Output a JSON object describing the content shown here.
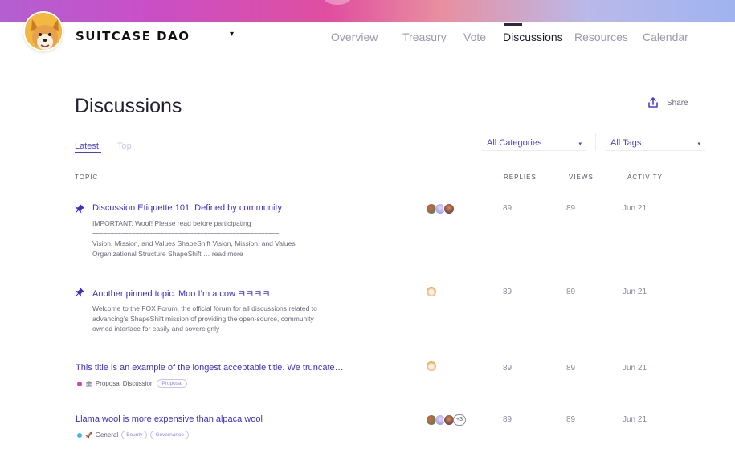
{
  "dao": {
    "name": "SUITCASE DAO",
    "menu_caret": "▾"
  },
  "nav": {
    "items": [
      "Overview",
      "Treasury",
      "Vote",
      "Discussions",
      "Resources",
      "Calendar"
    ],
    "active": "Discussions"
  },
  "page": {
    "title": "Discussions",
    "share_label": "Share"
  },
  "tabs": {
    "latest": "Latest",
    "top": "Top"
  },
  "filters": {
    "categories": "All Categories",
    "tags": "All Tags",
    "caret": "▾"
  },
  "table": {
    "headers": {
      "topic": "TOPIC",
      "replies": "REPLIES",
      "views": "VIEWS",
      "activity": "ACTIVITY"
    }
  },
  "topics": [
    {
      "title": "Discussion Etiquette 101: Defined by community",
      "pinned": true,
      "excerpt_lines": [
        "IMPORTANT: Woof! Please read before participating",
        "====================================================",
        "Vision, Mission, and Values ShapeShift Vision, Mission, and Values",
        "Organizational Structure ShapeShift …"
      ],
      "read_more": "read more",
      "replies": "89",
      "views": "89",
      "activity": "Jun 21"
    },
    {
      "title": "Another pinned topic. Moo I’m a cow ㅋㅋㅋㅋ",
      "pinned": true,
      "excerpt_lines": [
        "Welcome to the FOX Forum, the official forum for all discussions related to",
        "advancing’s ShapeShift mission of providing the open-source, community",
        "owned interface for easily and sovereignly"
      ],
      "replies": "89",
      "views": "89",
      "activity": "Jun 21"
    },
    {
      "title": "This title is an example of the longest acceptable title. We truncate…",
      "pinned": false,
      "category": {
        "icon": "🏛",
        "name": "Proposal Discussion",
        "color": "#d63fb5"
      },
      "tags": [
        "Proposal"
      ],
      "replies": "89",
      "views": "89",
      "activity": "Jun 21"
    },
    {
      "title": "Llama wool is more expensive than alpaca wool",
      "pinned": false,
      "category": {
        "icon": "🚀",
        "name": "General",
        "color": "#3fb7f0"
      },
      "tags": [
        "Bounty",
        "Governance"
      ],
      "extra_posters": "+3",
      "replies": "89",
      "views": "89",
      "activity": "Jun 21"
    }
  ],
  "colors": {
    "accent": "#4b3fcf",
    "link": "#3d2fc6"
  }
}
